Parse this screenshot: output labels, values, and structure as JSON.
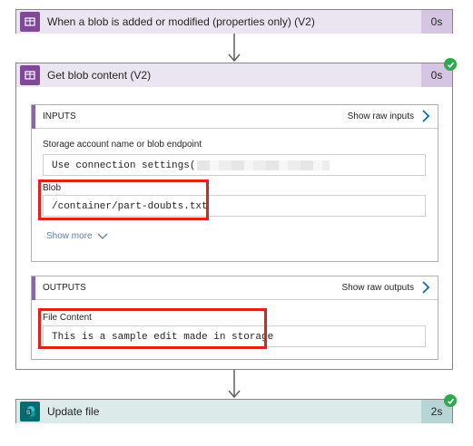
{
  "trigger": {
    "title": "When a blob is added or modified (properties only) (V2)",
    "duration": "0s",
    "icon": "azure-storage-icon"
  },
  "action": {
    "title": "Get blob content (V2)",
    "duration": "0s",
    "icon": "azure-storage-icon",
    "status": "succeeded",
    "inputs": {
      "heading": "INPUTS",
      "raw_link": "Show raw inputs",
      "fields": [
        {
          "label": "Storage account name or blob endpoint",
          "value": "Use connection settings("
        },
        {
          "label": "Blob",
          "value": "/container/part-doubts.txt"
        }
      ],
      "show_more": "Show more"
    },
    "outputs": {
      "heading": "OUTPUTS",
      "raw_link": "Show raw outputs",
      "fields": [
        {
          "label": "File Content",
          "value": "This is a sample edit made in storage"
        }
      ]
    }
  },
  "next_action": {
    "title": "Update file",
    "duration": "2s",
    "icon": "sharepoint-icon",
    "status": "succeeded"
  },
  "colors": {
    "storage_accent": "#804998",
    "sharepoint_accent": "#036c70",
    "success": "#2fa94e",
    "highlight": "#e0221b"
  }
}
